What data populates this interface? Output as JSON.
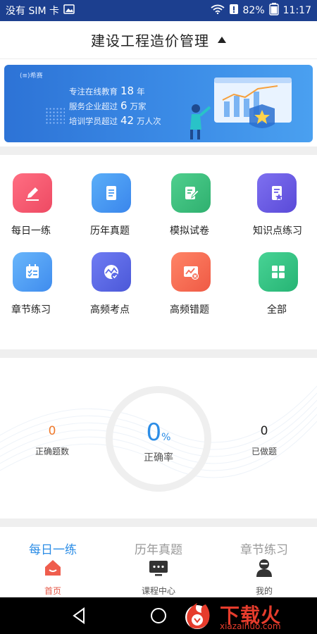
{
  "status_bar": {
    "carrier": "没有 SIM 卡",
    "battery": "82%",
    "time": "11:17"
  },
  "header": {
    "title": "建设工程造价管理"
  },
  "banner": {
    "logo": "(≡)希赛",
    "line1_pre": "专注在线教育",
    "line1_num": "18",
    "line1_post": "年",
    "line2_pre": "服务企业超过",
    "line2_num": "6",
    "line2_post": "万家",
    "line3_pre": "培训学员超过",
    "line3_num": "42",
    "line3_post": "万人次"
  },
  "features": [
    {
      "label": "每日一练",
      "icon": "pencil-icon",
      "color": "#f2576a"
    },
    {
      "label": "历年真题",
      "icon": "document-icon",
      "color": "#4a9cf3"
    },
    {
      "label": "模拟试卷",
      "icon": "edit-paper-icon",
      "color": "#3dbd7d"
    },
    {
      "label": "知识点练习",
      "icon": "star-document-icon",
      "color": "#6b5ce7"
    },
    {
      "label": "章节练习",
      "icon": "checklist-icon",
      "color": "#4a9cf3"
    },
    {
      "label": "高频考点",
      "icon": "target-check-icon",
      "color": "#5b69e6"
    },
    {
      "label": "高频错题",
      "icon": "chart-error-icon",
      "color": "#f46a55"
    },
    {
      "label": "全部",
      "icon": "grid-icon",
      "color": "#34c184"
    }
  ],
  "stats": {
    "correct_count": "0",
    "correct_count_label": "正确题数",
    "rate": "0",
    "rate_unit": "%",
    "rate_label": "正确率",
    "done_count": "0",
    "done_count_label": "已做题"
  },
  "ghost_tabs": [
    "每日一练",
    "历年真题",
    "章节练习"
  ],
  "bottom_nav": [
    {
      "label": "首页",
      "icon": "home-icon",
      "active": true
    },
    {
      "label": "课程中心",
      "icon": "course-icon",
      "active": false
    },
    {
      "label": "我的",
      "icon": "profile-icon",
      "active": false
    }
  ],
  "watermark": {
    "title": "下载火",
    "url": "xiazaihuo.com"
  },
  "colors": {
    "status_bar": "#1c3f8f",
    "accent": "#2c8de6",
    "active_nav": "#e65a4a",
    "correct_count": "#f07a2c"
  }
}
